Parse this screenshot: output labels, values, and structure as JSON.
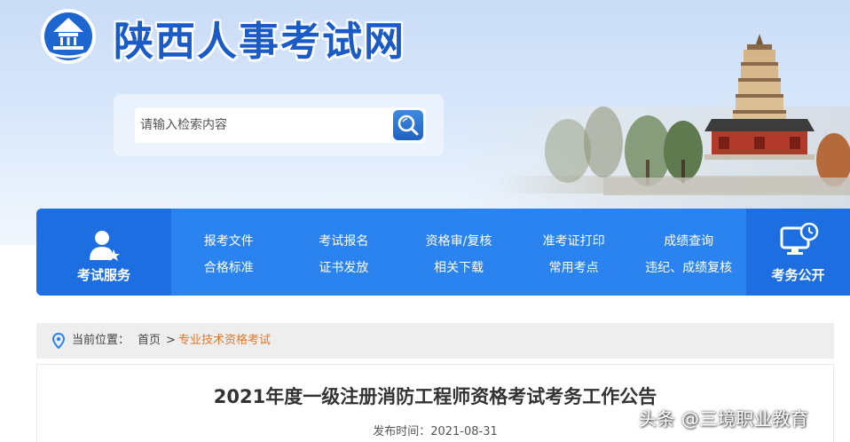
{
  "header": {
    "site_title": "陕西人事考试网"
  },
  "search": {
    "placeholder": "请输入检索内容",
    "button_icon": "search-icon"
  },
  "nav": {
    "left_label": "考试服务",
    "left_icon": "user-star-icon",
    "right_label": "考务公开",
    "right_icon": "monitor-clock-icon",
    "links_row1": [
      "报考文件",
      "考试报名",
      "资格审/复核",
      "准考证打印",
      "成绩查询"
    ],
    "links_row2": [
      "合格标准",
      "证书发放",
      "相关下载",
      "常用考点",
      "违纪、成绩复核"
    ]
  },
  "breadcrumb": {
    "icon": "location-pin-icon",
    "label": "当前位置：",
    "home": "首页",
    "separator": ">",
    "current": "专业技术资格考试"
  },
  "article": {
    "title": "2021年度一级注册消防工程师资格考试考务工作公告",
    "publish_label": "发布时间：",
    "publish_date": "2021-08-31"
  },
  "watermark": {
    "text": "头条 @三境职业教育"
  },
  "colors": {
    "brand_blue": "#1b5bc6",
    "nav_blue": "#2a83ef",
    "nav_dark_blue": "#1d6ee0",
    "breadcrumb_accent": "#e0782a"
  }
}
